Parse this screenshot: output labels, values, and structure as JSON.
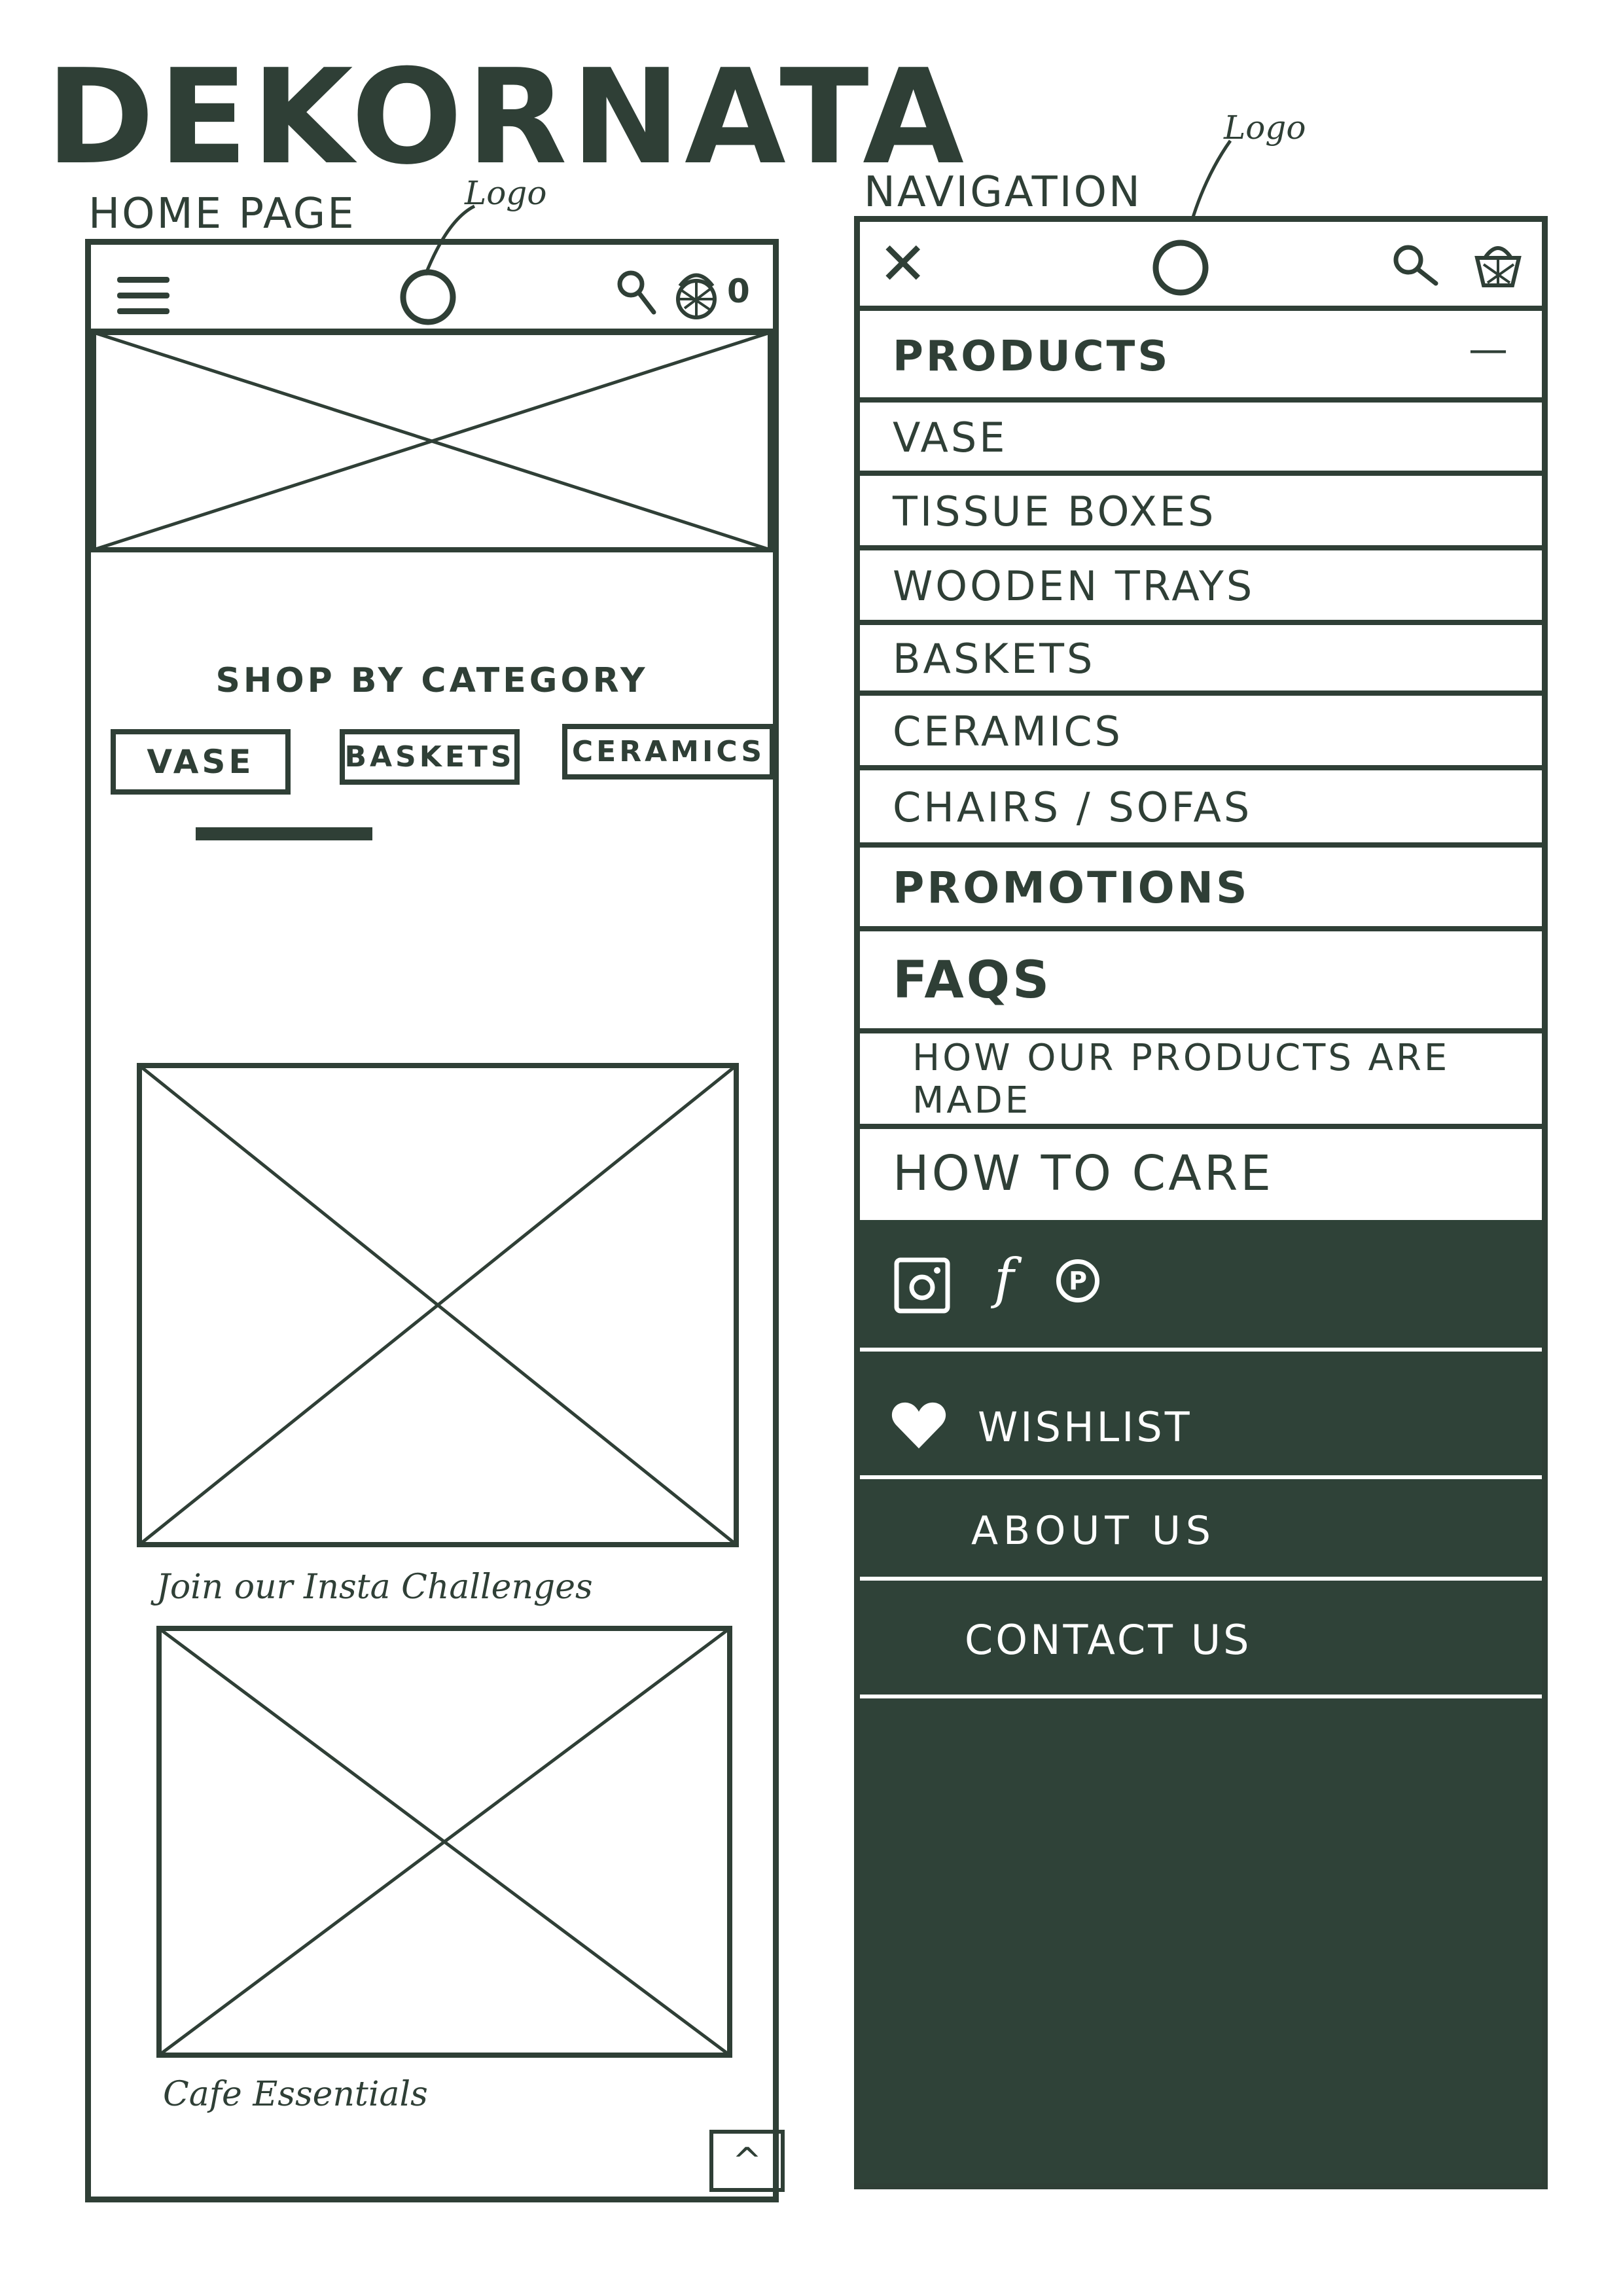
{
  "brand": "DEKORNATA",
  "home": {
    "title": "HOME PAGE",
    "logo_note": "Logo",
    "cart_count": "0",
    "section_heading": "SHOP BY CATEGORY",
    "categories": [
      "VASE",
      "BASKETS",
      "CERAMICS"
    ],
    "caption_1": "Join our Insta Challenges",
    "caption_2": "Cafe Essentials",
    "scroll_top_glyph": "^"
  },
  "navigation": {
    "title": "NAVIGATION",
    "logo_note": "Logo",
    "close_glyph": "✕",
    "collapse_glyph": "—",
    "products_label": "PRODUCTS",
    "product_items": [
      "VASE",
      "TISSUE BOXES",
      "WOODEN TRAYS",
      "BASKETS",
      "CERAMICS",
      "CHAIRS / SOFAS"
    ],
    "promotions": "PROMOTIONS",
    "faqs": "FAQS",
    "how_made": "HOW OUR PRODUCTS ARE MADE",
    "how_care": "HOW TO CARE",
    "social": {
      "instagram": "instagram-icon",
      "facebook": "f",
      "pinterest": "P"
    },
    "wishlist": "WISHLIST",
    "about": "ABOUT US",
    "contact": "CONTACT US"
  },
  "colors": {
    "ink": "#2f3f36",
    "dark_panel": "#2f4238",
    "paper": "#ffffff"
  }
}
